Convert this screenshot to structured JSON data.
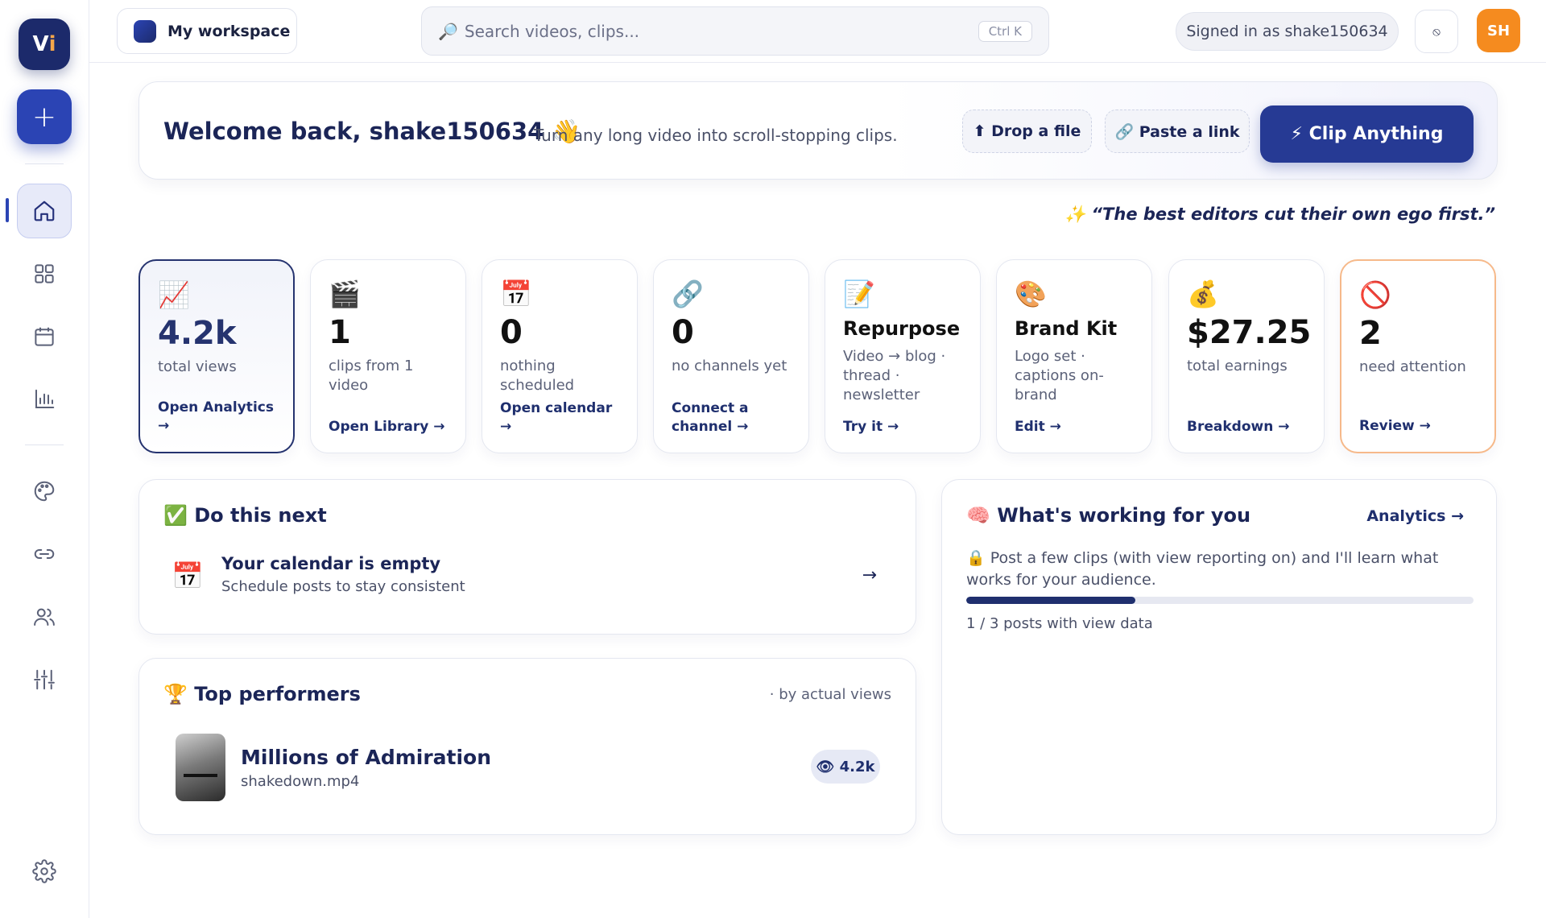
{
  "sidebar": {
    "logo_text": "Vi",
    "new_button_label": "+",
    "items": [
      {
        "name": "home",
        "active": true
      },
      {
        "name": "library"
      },
      {
        "name": "calendar"
      },
      {
        "name": "analytics"
      },
      {
        "name": "brand"
      },
      {
        "name": "links"
      },
      {
        "name": "team"
      },
      {
        "name": "tuning"
      },
      {
        "name": "settings"
      }
    ]
  },
  "topbar": {
    "workspace": "My workspace",
    "search_placeholder": "Search videos, clips...",
    "search_icon": "🔎",
    "search_shortcut": "Ctrl K",
    "signed_in": "Signed in as shake150634",
    "theme_icon": "⦸",
    "avatar_initials": "SH"
  },
  "welcome": {
    "title": "Welcome back, shake150634 👋",
    "subtitle": "Turn any long video into scroll-stopping clips.",
    "drop_file": "⬆ Drop a file",
    "paste_link": "🔗 Paste a link",
    "clip_anything": "⚡ Clip Anything"
  },
  "quote": "✨ “The best editors cut their own ego first.”",
  "stats": [
    {
      "icon": "📈",
      "value": "4.2k",
      "desc": "total views",
      "link": "Open Analytics →"
    },
    {
      "icon": "🎬",
      "value": "1",
      "desc": "clips from 1 video",
      "link": "Open Library →"
    },
    {
      "icon": "📅",
      "value": "0",
      "desc": "nothing scheduled",
      "link": "Open calendar →"
    },
    {
      "icon": "🔗",
      "value": "0",
      "desc": "no channels yet",
      "link": "Connect a channel →"
    },
    {
      "icon": "📝",
      "value": "Repurpose",
      "desc": "Video → blog · thread · newsletter",
      "link": "Try it →"
    },
    {
      "icon": "🎨",
      "value": "Brand Kit",
      "desc": "Logo set · captions on-brand",
      "link": "Edit →"
    },
    {
      "icon": "💰",
      "value": "$27.25",
      "desc": "total earnings",
      "link": "Breakdown →"
    },
    {
      "icon": "🚫",
      "value": "2",
      "desc": "need attention",
      "link": "Review →"
    }
  ],
  "do_next": {
    "title": "✅ Do this next",
    "item_icon": "📅",
    "item_title": "Your calendar is empty",
    "item_sub": "Schedule posts to stay consistent",
    "item_arrow": "→"
  },
  "top_performers": {
    "title": "🏆 Top performers",
    "note": "· by actual views",
    "items": [
      {
        "name": "Millions of Admiration",
        "file": "shakedown.mp4",
        "views": "👁 4.2k"
      }
    ]
  },
  "working": {
    "title": "🧠 What's working for you",
    "link": "Analytics →",
    "body": "🔒 Post a few clips (with view reporting on) and I'll learn what works for your audience.",
    "progress": 0.333,
    "caption": "1 / 3 posts with view data"
  },
  "colors": {
    "accent": "#263a94",
    "accent_dark": "#1c2a6b",
    "avatar": "#f58b1f",
    "warn_border": "#f6b98a"
  }
}
